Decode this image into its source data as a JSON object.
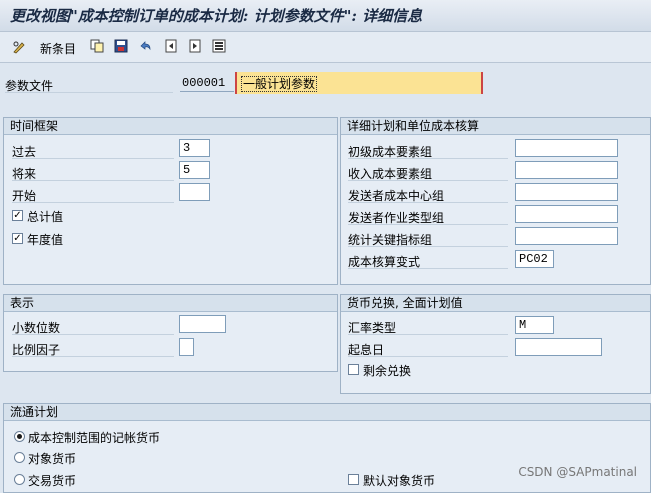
{
  "title": "更改视图\"成本控制订单的成本计划: 计划参数文件\": 详细信息",
  "toolbar": {
    "new_entries_label": "新条目",
    "icons": [
      "pencil-glasses-icon",
      "copy-icon",
      "save-icon",
      "undo-icon",
      "prev-entry-icon",
      "next-entry-icon",
      "select-all-icon"
    ]
  },
  "param_file": {
    "label": "参数文件",
    "code": "000001",
    "description": "一般计划参数"
  },
  "timeframe": {
    "title": "时间框架",
    "past_label": "过去",
    "past_value": "3",
    "future_label": "将来",
    "future_value": "5",
    "start_label": "开始",
    "start_value": "",
    "total_label": "总计值",
    "total_checked": true,
    "annual_label": "年度值",
    "annual_checked": true
  },
  "detail": {
    "title": "详细计划和单位成本核算",
    "primary_label": "初级成本要素组",
    "revenue_label": "收入成本要素组",
    "sender_cc_label": "发送者成本中心组",
    "sender_at_label": "发送者作业类型组",
    "stat_kf_label": "统计关键指标组",
    "costing_variant_label": "成本核算变式",
    "costing_variant_value": "PC02"
  },
  "display": {
    "title": "表示",
    "decimals_label": "小数位数",
    "scale_label": "比例因子"
  },
  "currency": {
    "title": "货币兑换, 全面计划值",
    "rate_type_label": "汇率类型",
    "rate_type_value": "M",
    "value_date_label": "起息日",
    "remaining_label": "剩余兑换",
    "remaining_checked": false
  },
  "flow": {
    "title": "流通计划",
    "opt1_label": "成本控制范围的记帐货币",
    "opt2_label": "对象货币",
    "opt3_label": "交易货币",
    "default_obj_label": "默认对象货币",
    "selected": 1
  },
  "watermark": "CSDN @SAPmatinal"
}
